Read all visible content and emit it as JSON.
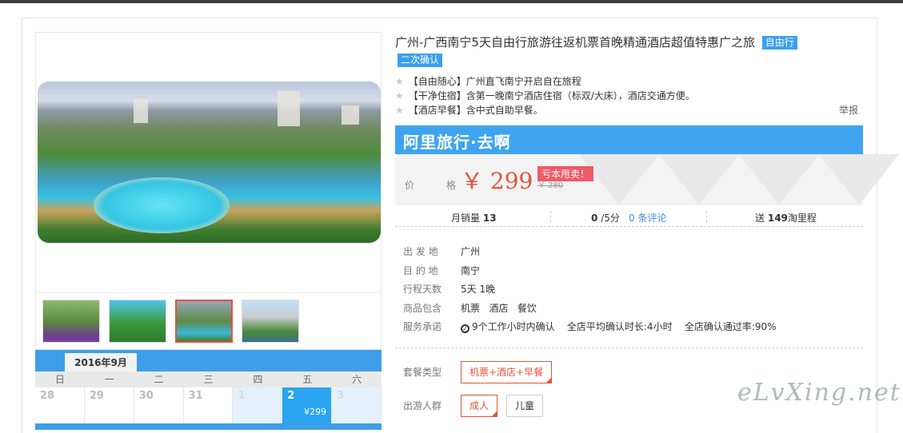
{
  "product": {
    "title": "广州-广西南宁5天自由行旅游往返机票首晚精通酒店超值特惠广之旅",
    "tags": [
      "自由行",
      "二次确认"
    ],
    "features": [
      "【自由随心】广州直飞南宁开启自在旅程",
      "【干净住宿】含第一晚南宁酒店住宿（标双/大床），酒店交通方便。",
      "【酒店早餐】含中式自助早餐。"
    ],
    "report_label": "举报"
  },
  "price_box": {
    "brand": "阿里旅行·去啊",
    "price_label": "价 格",
    "price": "￥ 299",
    "promo": "亏本甩卖！",
    "old_price": "￥ 280"
  },
  "stats": {
    "sales_label": "月销量",
    "sales_value": "13",
    "rating_value": "0",
    "rating_suffix": "/5分",
    "reviews": "0 条评论",
    "points_prefix": "送",
    "points_value": "149",
    "points_suffix": "淘里程"
  },
  "info": [
    {
      "label": "出 发 地",
      "value": "广州"
    },
    {
      "label": "目 的 地",
      "value": "南宁"
    },
    {
      "label": "行程天数",
      "value": "5天 1晚"
    },
    {
      "label": "商品包含",
      "value": "机票   酒店   餐饮"
    },
    {
      "label": "服务承诺",
      "value": "9个工作小时内确认    全店平均确认时长:4小时    全店确认通过率:90%"
    }
  ],
  "package": {
    "type_label": "套餐类型",
    "type_option": "机票+酒店+早餐",
    "people_label": "出游人群",
    "people_options": [
      "成人",
      "儿童"
    ]
  },
  "calendar": {
    "month": "2016年9月",
    "weekdays": [
      "日",
      "一",
      "二",
      "三",
      "四",
      "五",
      "六"
    ],
    "days": [
      "28",
      "29",
      "30",
      "31",
      "1",
      "2",
      "3"
    ],
    "selected_price": "¥299"
  },
  "watermark": "eLvXing.net",
  "colors": {
    "accent": "#3fa4ef",
    "price": "#e4533a",
    "promo": "#f05a66"
  }
}
